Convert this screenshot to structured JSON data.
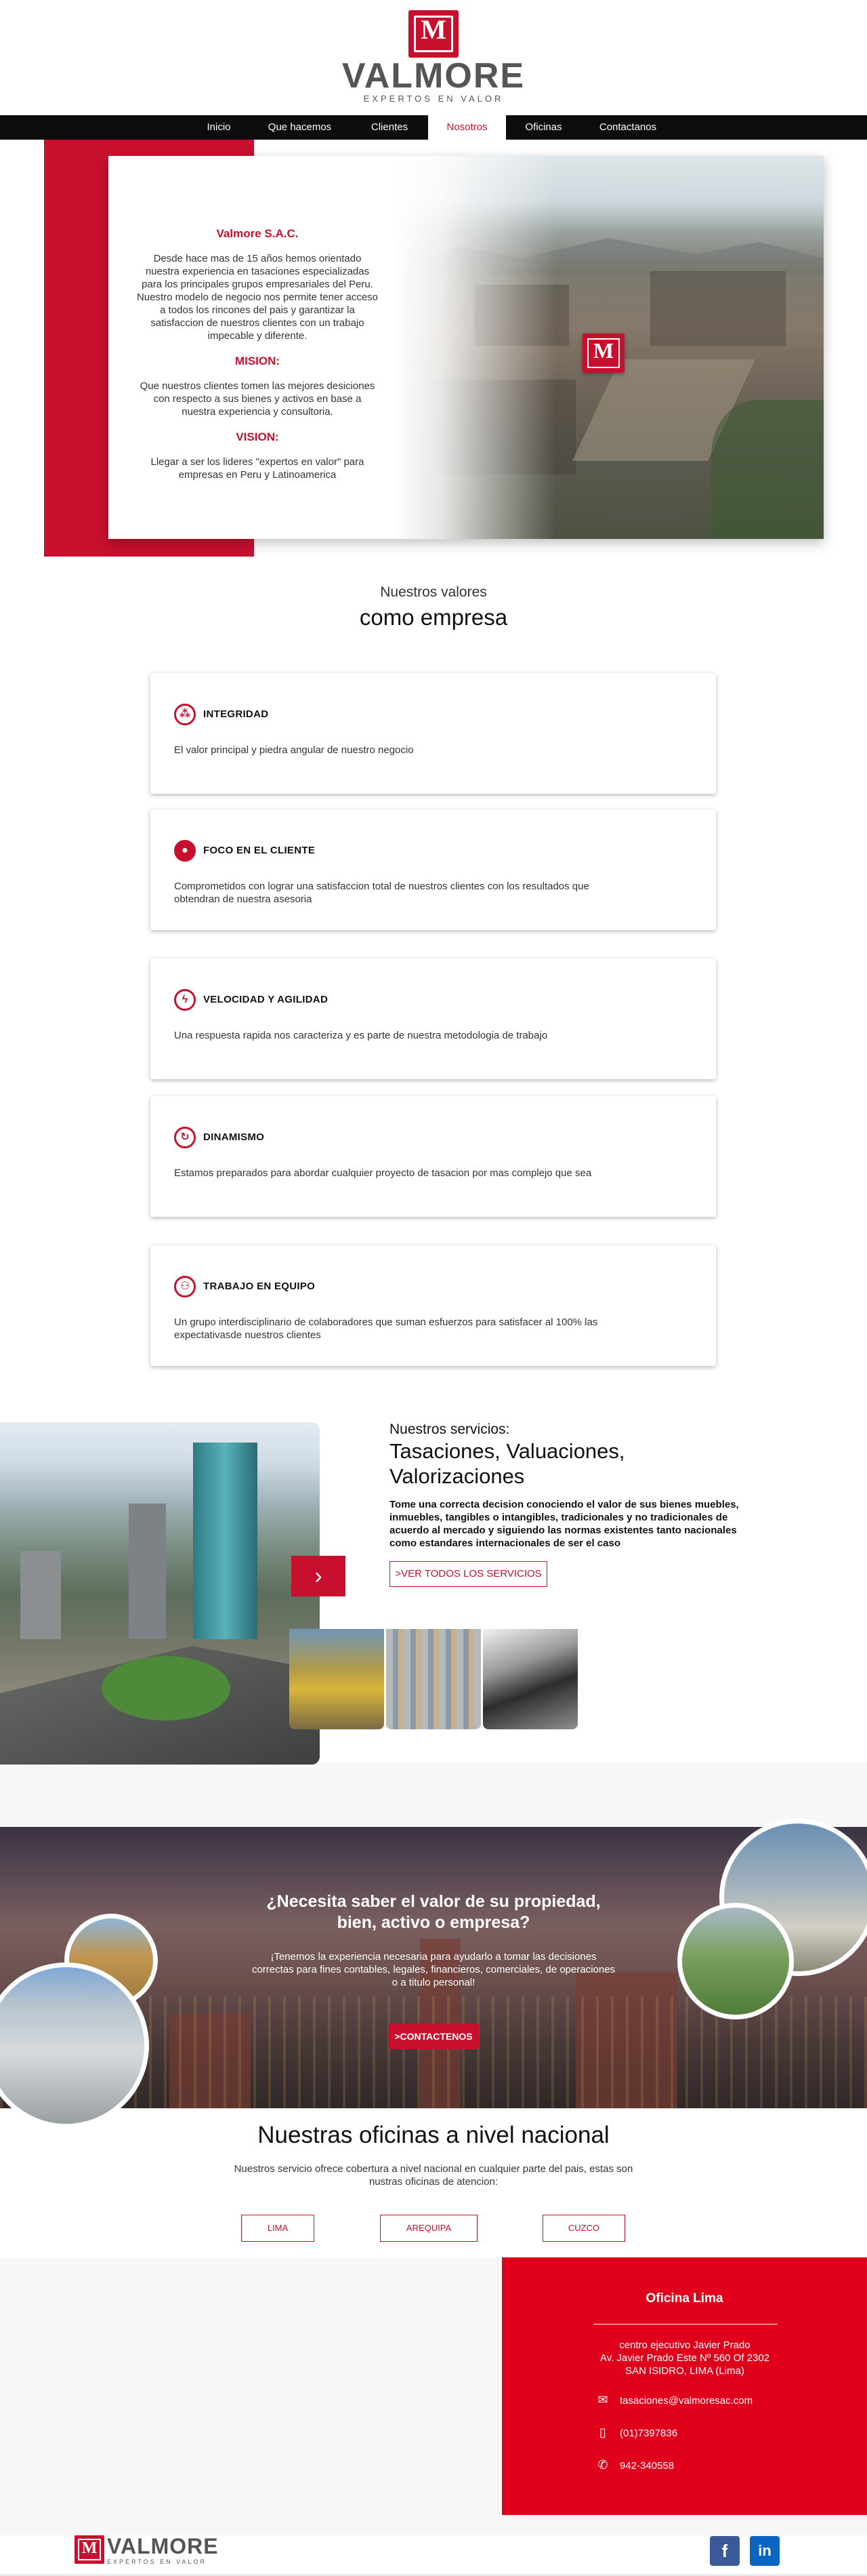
{
  "header": {
    "logo_letter": "M",
    "brand_name": "VALMORE",
    "tagline": "EXPERTOS EN VALOR"
  },
  "nav": {
    "items": [
      {
        "label": "Inicio"
      },
      {
        "label": "Que hacemos"
      },
      {
        "label": "Clientes"
      },
      {
        "label": "Nosotros"
      },
      {
        "label": "Oficinas"
      },
      {
        "label": "Contactanos"
      }
    ],
    "active": "Nosotros"
  },
  "about": {
    "company": "Valmore S.A.C.",
    "intro": "Desde hace mas de 15 años hemos orientado nuestra experiencia en tasaciones especializadas para los principales grupos empresariales del Peru. Nuestro modelo de negocio nos permite tener acceso a todos los rincones del pais y garantizar la satisfaccion de nuestros clientes con un trabajo impecable y diferente.",
    "mision_title": "MISION:",
    "mision": "Que nuestros clientes tomen las mejores desiciones con respecto a sus bienes y activos en base a nuestra experiencia y consultoria.",
    "vision_title": "VISION:",
    "vision": "Llegar a ser los lideres \"expertos en valor\" para empresas en Peru y Latinoamerica",
    "image_logo_letter": "M"
  },
  "values": {
    "subtitle": "Nuestros valores",
    "title": "como empresa",
    "items": [
      {
        "icon": "integrity-icon",
        "glyph": "⁂",
        "title": "INTEGRIDAD",
        "desc": "El valor principal y piedra angular de nuestro negocio"
      },
      {
        "icon": "user-icon",
        "glyph": "●",
        "title": "FOCO EN EL CLIENTE",
        "desc": "Comprometidos con lograr una satisfaccion total de nuestros clientes con los resultados que obtendran de nuestra asesoria"
      },
      {
        "icon": "lightning-icon",
        "glyph": "ϟ",
        "title": "VELOCIDAD Y AGILIDAD",
        "desc": "Una respuesta rapida nos caracteriza y es parte de nuestra metodologia de trabajo"
      },
      {
        "icon": "dynamism-icon",
        "glyph": "↻",
        "title": "DINAMISMO",
        "desc": "Estamos preparados para abordar cualquier proyecto de tasacion por mas complejo que sea"
      },
      {
        "icon": "team-icon",
        "glyph": "⚇",
        "title": "TRABAJO EN EQUIPO",
        "desc": "Un grupo interdisciplinario de colaboradores que suman esfuerzos para satisfacer al 100% las expectativasde nuestros clientes"
      }
    ]
  },
  "services": {
    "subtitle": "Nuestros servicios:",
    "title": "Tasaciones, Valuaciones, Valorizaciones",
    "description": "Tome una correcta decision conociendo el valor de sus bienes muebles, inmuebles, tangibles o intangibles, tradicionales y no tradicionales de acuerdo al mercado y siguiendo las normas existentes tanto nacionales como estandares internacionales de ser el caso",
    "button": ">VER TODOS LOS SERVICIOS",
    "arrow": "›"
  },
  "cta": {
    "title": "¿Necesita saber el valor de su propiedad, bien, activo o empresa?",
    "description": "¡Tenemos la experiencia necesaria para ayudarlo a tomar las decisiones correctas para fines contables, legales, financieros, comerciales, de operaciones o a titulo personal!",
    "button": ">CONTACTENOS"
  },
  "offices": {
    "title": "Nuestras oficinas a nivel nacional",
    "description": "Nuestros servicio ofrece cobertura a nivel nacional en cualquier parte del pais, estas son nustras oficinas de atencion:",
    "buttons": [
      {
        "label": "LIMA"
      },
      {
        "label": "AREQUIPA"
      },
      {
        "label": "CUZCO"
      }
    ]
  },
  "contact": {
    "title": "Oficina Lima",
    "address_line1": "centro ejecutivo Javier Prado",
    "address_line2": "Av. Javier Prado Este Nº 560 Of 2302",
    "address_line3": "SAN ISIDRO, LIMA (Lima)",
    "email": "tasaciones@valmoresac.com",
    "phone": "(01)7397836",
    "mobile": "942-340558"
  },
  "footer": {
    "logo_letter": "M",
    "brand_name": "VALMORE",
    "tagline": "EXPERTOS EN VALOR",
    "facebook": "f",
    "linkedin": "in"
  },
  "colors": {
    "brand_red": "#c8102e",
    "contact_red": "#e0001b",
    "nav_bg": "#0d0d0d"
  }
}
